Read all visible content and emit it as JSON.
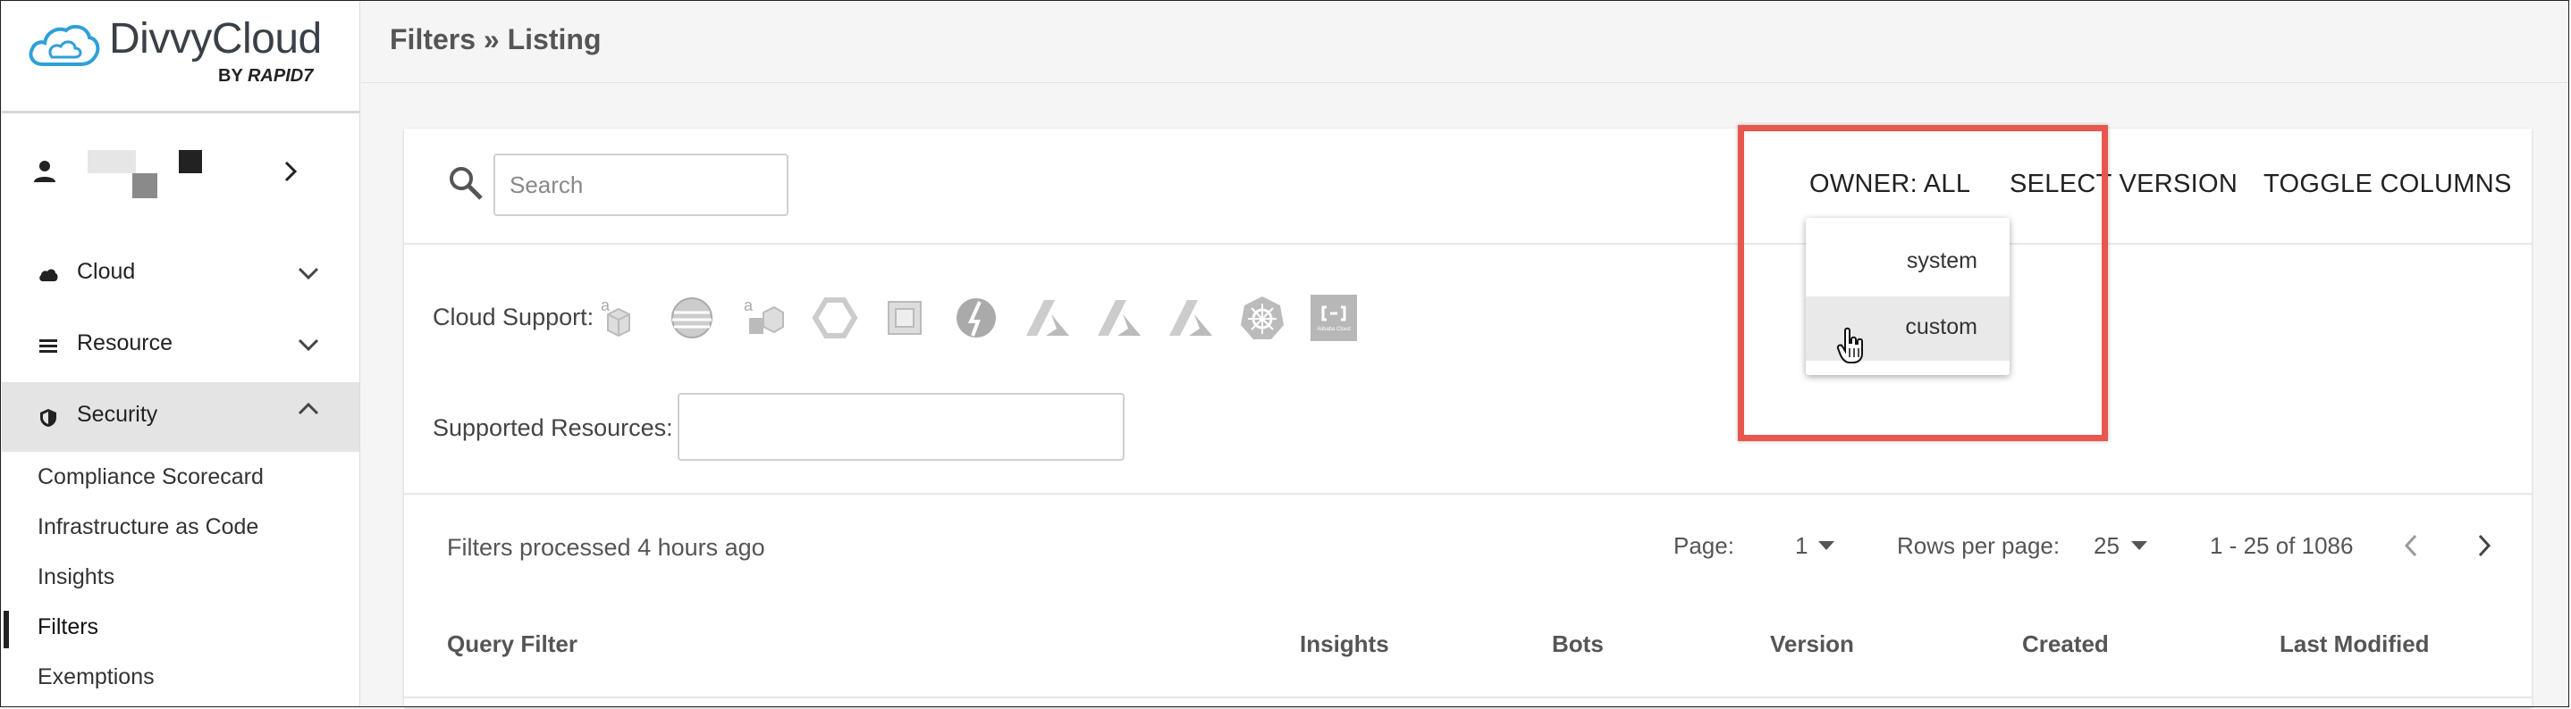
{
  "brand": {
    "name": "DivvyCloud",
    "by_prefix": "BY",
    "by_brand": "RAPID7"
  },
  "user": {
    "chevron": "chevron-right-icon"
  },
  "nav": {
    "cloud": "Cloud",
    "resource": "Resource",
    "security": "Security",
    "security_items": [
      "Compliance Scorecard",
      "Infrastructure as Code",
      "Insights",
      "Filters",
      "Exemptions"
    ]
  },
  "header": {
    "title": "Filters » Listing"
  },
  "toolbar": {
    "search_placeholder": "Search",
    "owner": "OWNER: ALL",
    "select_version": "SELECT VERSION",
    "toggle_columns": "TOGGLE COLUMNS"
  },
  "owner_dropdown": {
    "options": [
      "system",
      "custom"
    ],
    "hovered": "custom"
  },
  "filters": {
    "cloud_support_label": "Cloud Support:",
    "cloud_icons": [
      "aws-icon",
      "aws-gov-icon",
      "aws-china-icon",
      "gcp-icon",
      "oracle-icon",
      "ibm-icon",
      "azure-icon",
      "azure-gov-icon",
      "azure-china-icon",
      "kubernetes-icon",
      "alibaba-icon"
    ],
    "alibaba_text": "Alibaba Cloud",
    "supported_resources_label": "Supported Resources:"
  },
  "status": {
    "processed": "Filters processed 4 hours ago"
  },
  "pagination": {
    "page_label": "Page:",
    "page": "1",
    "rows_label": "Rows per page:",
    "rows": "25",
    "range": "1 - 25 of 1086"
  },
  "table": {
    "columns": [
      "Query Filter",
      "Insights",
      "Bots",
      "Version",
      "Created",
      "Last Modified"
    ]
  },
  "colors": {
    "highlight": "#e8564d",
    "accent": "#2f9fd8"
  }
}
